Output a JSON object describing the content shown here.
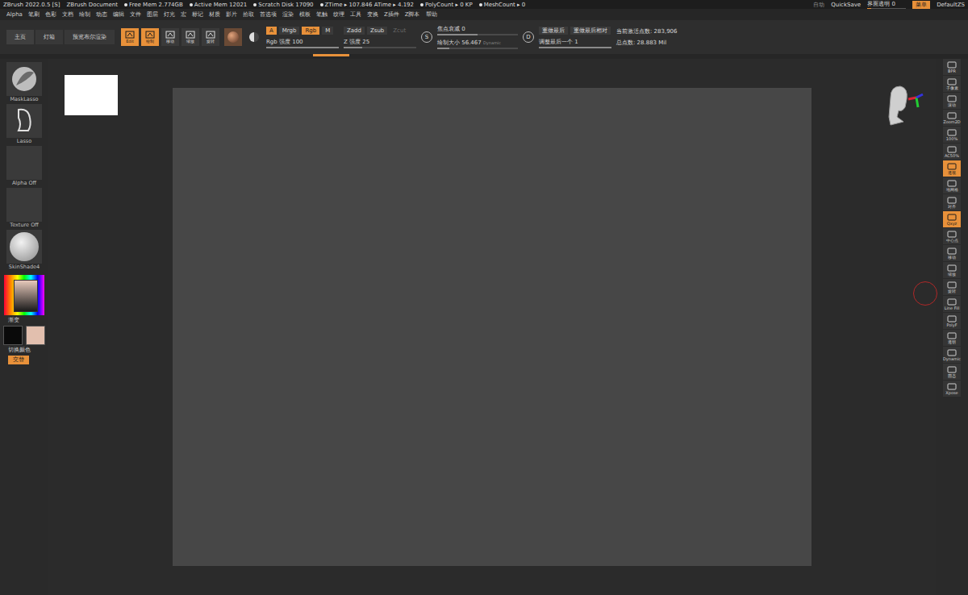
{
  "title_bar": {
    "app": "ZBrush 2022.0.5 [S]",
    "document": "ZBrush Document",
    "stats": [
      "Free Mem 2.774GB",
      "Active Mem 12021",
      "Scratch Disk 17090",
      "ZTime ▸ 107.846 ATime ▸ 4.192",
      "PolyCount ▸ 0 KP",
      "MeshCount ▸ 0"
    ],
    "auto": "自动",
    "quicksave": "QuickSave",
    "transparency": {
      "label": "界面透明 0",
      "level": 0.1
    },
    "menus_button": "菜单",
    "layout": "DefaultZS"
  },
  "menu": [
    "Alpha",
    "笔刷",
    "色彩",
    "文档",
    "绘制",
    "动态",
    "编辑",
    "文件",
    "图层",
    "灯光",
    "宏",
    "标记",
    "材质",
    "影片",
    "拾取",
    "首选项",
    "渲染",
    "模板",
    "笔触",
    "纹理",
    "工具",
    "变换",
    "Z插件",
    "Z脚本",
    "帮助"
  ],
  "toolbar": {
    "tabs": [
      {
        "label": "主页",
        "selected": true
      },
      {
        "label": "灯箱",
        "selected": false
      },
      {
        "label": "预览布尔渲染",
        "selected": false
      }
    ],
    "modes": [
      {
        "label": "Edit",
        "selected": true
      },
      {
        "label": "绘制",
        "selected": true
      },
      {
        "label": "移动",
        "selected": false
      },
      {
        "label": "缩放",
        "selected": false
      },
      {
        "label": "旋转",
        "selected": false
      }
    ],
    "channels": [
      {
        "label": "A",
        "selected": true
      },
      {
        "label": "Mrgb",
        "selected": false
      },
      {
        "label": "Rgb",
        "selected": true
      },
      {
        "label": "M",
        "selected": false
      }
    ],
    "depth": [
      {
        "label": "Zadd",
        "selected": false,
        "disabled": false
      },
      {
        "label": "Zsub",
        "selected": false,
        "disabled": false
      },
      {
        "label": "Zcut",
        "selected": false,
        "disabled": true
      }
    ],
    "rgb_intensity": {
      "label": "Rgb 强度",
      "value": "100",
      "level": 1
    },
    "z_intensity": {
      "label": "Z 强度",
      "value": "25",
      "level": 0.25
    },
    "stroke_badge": "S",
    "focal_shift": {
      "label": "焦点衰减",
      "value": "0",
      "level": 0.5
    },
    "draw_size": {
      "label": "绘制大小",
      "value": "56.467",
      "level": 0.15
    },
    "dynamic": "Dynamic",
    "redo_badge": "D",
    "redo": [
      "重做最后",
      "重做最后相对"
    ],
    "adjust_last": {
      "label": "调整最后一个",
      "value": "1",
      "level": 1
    },
    "active_points": "当前激活点数: 283,906",
    "total_points": "总点数: 28.883 Mil"
  },
  "left_shelf": {
    "tools": [
      {
        "label": "MaskLasso"
      },
      {
        "label": "Lasso"
      },
      {
        "label": "Alpha Off"
      },
      {
        "label": "Texture Off"
      },
      {
        "label": "SkinShade4"
      }
    ],
    "gradient": "渐变",
    "swatches": [
      {
        "color": "#0a0a0a"
      },
      {
        "color": "#e2bfae"
      }
    ],
    "switch": "切换颜色",
    "alternate": {
      "label": "交替",
      "on": true
    }
  },
  "right_shelf": [
    {
      "label": "BPR",
      "selected": false
    },
    {
      "label": "子像素",
      "selected": false
    },
    {
      "label": "滚动",
      "selected": false
    },
    {
      "label": "Zoom2D",
      "selected": false
    },
    {
      "label": "100%",
      "selected": false
    },
    {
      "label": "AC50%",
      "selected": false
    },
    {
      "label": "透视",
      "selected": true
    },
    {
      "label": "地网格",
      "selected": false
    },
    {
      "label": "对齐",
      "selected": false
    },
    {
      "label": "Qxyz",
      "selected": true
    },
    {
      "label": "中心点",
      "selected": false
    },
    {
      "label": "移动",
      "selected": false
    },
    {
      "label": "缩放",
      "selected": false
    },
    {
      "label": "旋转",
      "selected": false
    },
    {
      "label": "Line Fill",
      "selected": false
    },
    {
      "label": "PolyF",
      "selected": false
    },
    {
      "label": "透明",
      "selected": false
    },
    {
      "label": "Dynamic",
      "selected": false
    },
    {
      "label": "固态",
      "selected": false
    },
    {
      "label": "Xpose",
      "selected": false
    }
  ]
}
